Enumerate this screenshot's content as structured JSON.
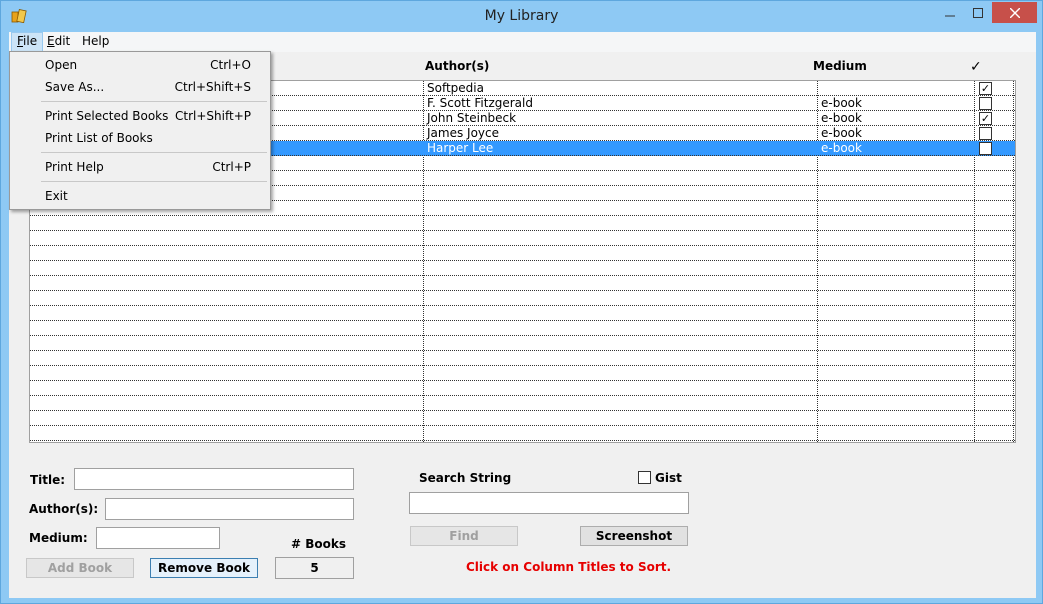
{
  "window": {
    "title": "My Library"
  },
  "menubar": {
    "file": {
      "label": "File",
      "accel": "F",
      "rest": "ile"
    },
    "edit": {
      "label": "Edit",
      "accel": "E",
      "rest": "dit"
    },
    "help": {
      "label": "Help"
    }
  },
  "file_menu": {
    "items": [
      {
        "label": "Open",
        "shortcut": "Ctrl+O"
      },
      {
        "label": "Save As...",
        "shortcut": "Ctrl+Shift+S"
      },
      {
        "label": "Print Selected Books",
        "shortcut": "Ctrl+Shift+P"
      },
      {
        "label": "Print List of Books",
        "shortcut": ""
      },
      {
        "label": "Print Help",
        "shortcut": "Ctrl+P"
      },
      {
        "label": "Exit",
        "shortcut": ""
      }
    ]
  },
  "table": {
    "columns": {
      "author": "Author(s)",
      "medium": "Medium",
      "check": "✓"
    },
    "rows": [
      {
        "title": "",
        "author": "Softpedia",
        "medium": "",
        "checked": true,
        "selected": false
      },
      {
        "title": "",
        "author": "F. Scott Fitzgerald",
        "medium": "e-book",
        "checked": false,
        "selected": false
      },
      {
        "title": "",
        "author": "John Steinbeck",
        "medium": "e-book",
        "checked": true,
        "selected": false
      },
      {
        "title": "",
        "author": "James Joyce",
        "medium": "e-book",
        "checked": false,
        "selected": false
      },
      {
        "title": "",
        "author": "Harper Lee",
        "medium": "e-book",
        "checked": false,
        "selected": true
      }
    ]
  },
  "form": {
    "title_label": "Title:",
    "title_value": "",
    "author_label": "Author(s):",
    "author_value": "",
    "medium_label": "Medium:",
    "medium_value": "",
    "add_book": "Add Book",
    "remove_book": "Remove Book",
    "books_count_label": "# Books",
    "books_count": "5"
  },
  "search": {
    "label": "Search String",
    "value": "",
    "gist_label": "Gist",
    "gist_checked": false,
    "find": "Find",
    "screenshot": "Screenshot",
    "hint": "Click on Column Titles to Sort."
  },
  "colors": {
    "selection": "#3399ff",
    "hint": "#e60000",
    "titlebar": "#8ec9f4",
    "close": "#c7504a"
  }
}
